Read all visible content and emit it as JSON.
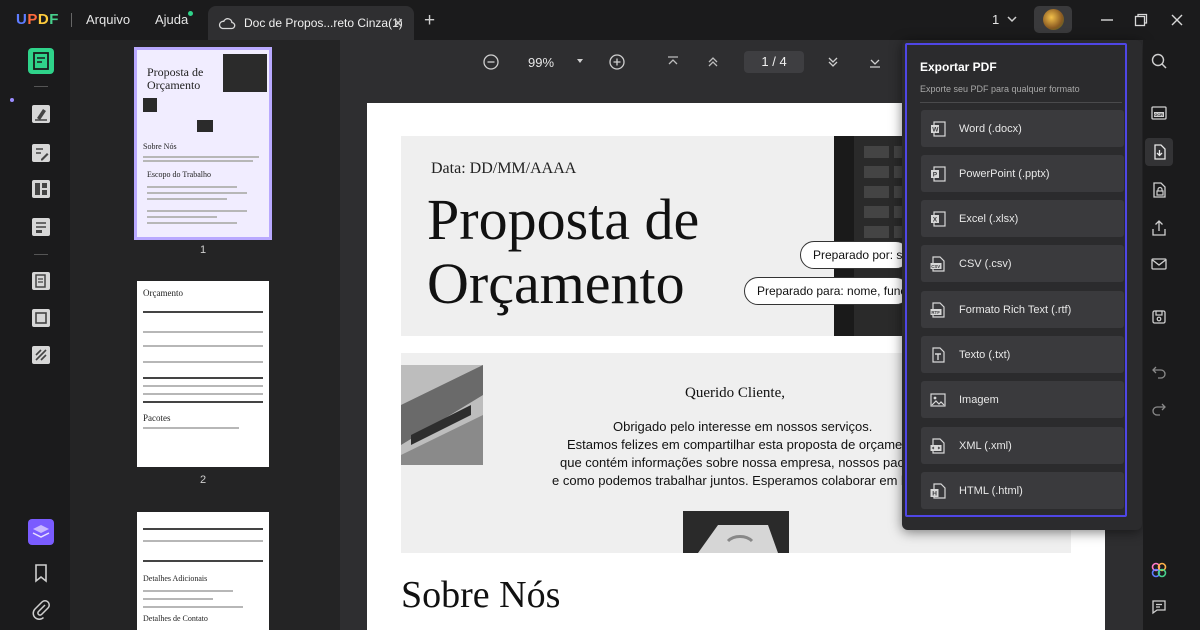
{
  "app": {
    "logo": [
      "U",
      "P",
      "D",
      "F"
    ],
    "menu": [
      "Arquivo",
      "Ajuda"
    ],
    "tab_label": "Doc de Propos...reto Cinza(1)",
    "tab_close": "✕",
    "tab_add": "+",
    "window_count": "1",
    "colors": {
      "accent": "#4f46e5",
      "selection": "#b9a9ff",
      "dot": "#2fd38a"
    }
  },
  "toolbar": {
    "zoom": "99%",
    "page_current": "1",
    "page_sep": "/",
    "page_total": "4"
  },
  "thumbnails": [
    {
      "num": "1",
      "title": "Proposta de Orçamento",
      "sobre": "Sobre Nós",
      "escopo": "Escopo do Trabalho"
    },
    {
      "num": "2",
      "title": "Orçamento",
      "pacotes": "Pacotes"
    },
    {
      "num": "",
      "detalhes": "Detalhes Adicionais",
      "contato": "Detalhes de Contato"
    }
  ],
  "document": {
    "date": "Data: DD/MM/AAAA",
    "title_line1": "Proposta de",
    "title_line2": "Orçamento",
    "prepared_by": "Preparado por: se",
    "prepared_for": "Preparado para: nome, funçã",
    "greeting": "Querido Cliente,",
    "body": [
      "Obrigado pelo interesse em nossos serviços.",
      "Estamos felizes em compartilhar esta proposta de orçamento",
      "que contém informações sobre nossa empresa, nossos pacote",
      "e como podemos trabalhar juntos. Esperamos colaborar em bre"
    ],
    "sobre": "Sobre Nós"
  },
  "export_panel": {
    "title": "Exportar PDF",
    "subtitle": "Exporte seu PDF para qualquer formato",
    "options": [
      {
        "label": "Word (.docx)",
        "icon": "word-icon"
      },
      {
        "label": "PowerPoint (.pptx)",
        "icon": "powerpoint-icon"
      },
      {
        "label": "Excel (.xlsx)",
        "icon": "excel-icon"
      },
      {
        "label": "CSV (.csv)",
        "icon": "csv-icon"
      },
      {
        "label": "Formato Rich Text (.rtf)",
        "icon": "rtf-icon"
      },
      {
        "label": "Texto (.txt)",
        "icon": "text-file-icon"
      },
      {
        "label": "Imagem",
        "icon": "image-icon"
      },
      {
        "label": "XML (.xml)",
        "icon": "xml-icon"
      },
      {
        "label": "HTML (.html)",
        "icon": "html-icon"
      }
    ]
  }
}
